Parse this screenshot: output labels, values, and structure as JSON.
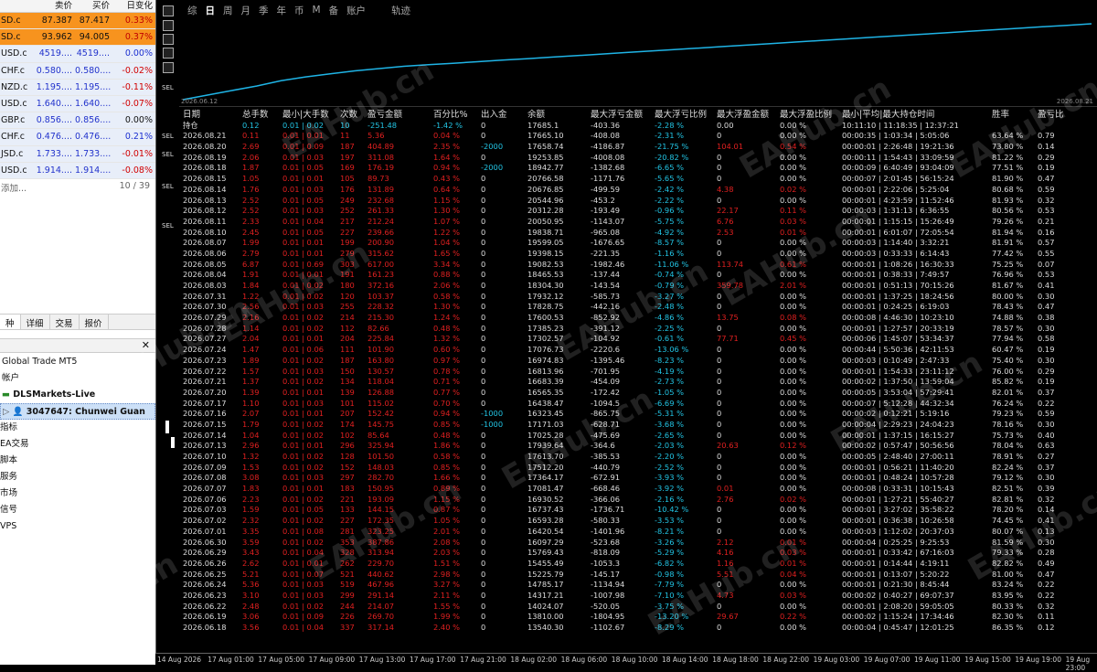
{
  "market_watch": {
    "headers": [
      "",
      "卖价",
      "买价",
      "日变化"
    ],
    "rows": [
      {
        "symbol": "SD.c",
        "bid": "87.387",
        "ask": "87.417",
        "change": "0.33%",
        "highlight": true,
        "dir": "pos"
      },
      {
        "symbol": "SD.c",
        "bid": "93.962",
        "ask": "94.005",
        "change": "0.37%",
        "highlight": true,
        "dir": "pos"
      },
      {
        "symbol": "USD.c",
        "bid": "4519....",
        "ask": "4519....",
        "change": "0.00%",
        "highlight": false,
        "dir": "pos"
      },
      {
        "symbol": "CHF.c",
        "bid": "0.580....",
        "ask": "0.580....",
        "change": "-0.02%",
        "highlight": false,
        "dir": "neg"
      },
      {
        "symbol": "NZD.c",
        "bid": "1.195....",
        "ask": "1.195....",
        "change": "-0.11%",
        "highlight": false,
        "dir": "neg"
      },
      {
        "symbol": "USD.c",
        "bid": "1.640....",
        "ask": "1.640....",
        "change": "-0.07%",
        "highlight": false,
        "dir": "neg"
      },
      {
        "symbol": "GBP.c",
        "bid": "0.856....",
        "ask": "0.856....",
        "change": "0.00%",
        "highlight": false,
        "dir": "none"
      },
      {
        "symbol": "CHF.c",
        "bid": "0.476....",
        "ask": "0.476....",
        "change": "0.21%",
        "highlight": false,
        "dir": "pos"
      },
      {
        "symbol": "JSD.c",
        "bid": "1.733....",
        "ask": "1.733....",
        "change": "-0.01%",
        "highlight": false,
        "dir": "neg"
      },
      {
        "symbol": "USD.c",
        "bid": "1.914....",
        "ask": "1.914....",
        "change": "-0.08%",
        "highlight": false,
        "dir": "neg"
      }
    ],
    "add_label": "添加...",
    "count": "10 / 39"
  },
  "tabs": [
    "种",
    "详细",
    "交易",
    "报价"
  ],
  "navigator": {
    "items": [
      "Global Trade MT5",
      "帐户",
      "DLSMarkets-Live",
      "3047647: Chunwei Guan",
      "指标",
      "EA交易",
      "脚本",
      "服务",
      "市场",
      "信号",
      "VPS"
    ]
  },
  "toolbar": {
    "items": [
      "综",
      "日",
      "周",
      "月",
      "季",
      "年",
      "币",
      "M",
      "备",
      "账户",
      "轨迹"
    ],
    "active_index": 1
  },
  "chart": {
    "date_left": "2026.06.12",
    "date_right": "2026.08.21",
    "series_color": "#1fb4e6",
    "equity": [
      0,
      0.06,
      0.12,
      0.18,
      0.25,
      0.3,
      0.34,
      0.38,
      0.41,
      0.44,
      0.46,
      0.48,
      0.5,
      0.52,
      0.54,
      0.56,
      0.58,
      0.6,
      0.62,
      0.64,
      0.66,
      0.68,
      0.7,
      0.72,
      0.74,
      0.76,
      0.78,
      0.8,
      0.82,
      0.84,
      0.86,
      0.88,
      0.9,
      0.92,
      0.94,
      0.96,
      0.98,
      1.0
    ]
  },
  "grid": {
    "headers": [
      "日期",
      "总手数",
      "最小|大手数",
      "次数",
      "盈亏金额",
      "百分比%",
      "出入金",
      "余额",
      "最大浮亏金额",
      "最大浮亏比例",
      "最大浮盈金额",
      "最大浮盈比例",
      "最小|平均|最大持仓时间",
      "胜率",
      "盈亏比"
    ],
    "rows": [
      [
        "持仓",
        "0.12",
        "0.01 | 0.02",
        "10",
        "-251.48",
        "-1.42 %",
        "0",
        "17685.1",
        "-403.36",
        "-2.28 %",
        "0.00",
        "0.00 %",
        "10:11:10 | 11:18:35 | 12:37:21",
        "",
        ""
      ],
      [
        "2026.08.21",
        "0.11",
        "0.01 | 0.01",
        "11",
        "5.36",
        "0.04 %",
        "0",
        "17665.10",
        "-408.08",
        "-2.31 %",
        "0",
        "0.00 %",
        "00:00:35 | 1:03:34 | 5:05:06",
        "63.64 %",
        "0.79"
      ],
      [
        "2026.08.20",
        "2.69",
        "0.01 | 0.09",
        "187",
        "404.89",
        "2.35 %",
        "-2000",
        "17658.74",
        "-4186.87",
        "-21.75 %",
        "104.01",
        "0.54 %",
        "00:00:01 | 2:26:48 | 19:21:36",
        "73.80 %",
        "0.14"
      ],
      [
        "2026.08.19",
        "2.06",
        "0.01 | 0.03",
        "197",
        "311.08",
        "1.64 %",
        "0",
        "19253.85",
        "-4008.08",
        "-20.82 %",
        "0",
        "0.00 %",
        "00:00:11 | 1:54:43 | 33:09:59",
        "81.22 %",
        "0.29"
      ],
      [
        "2026.08.18",
        "1.87",
        "0.01 | 0.05",
        "169",
        "176.19",
        "0.94 %",
        "-2000",
        "18942.77",
        "-1382.68",
        "-6.65 %",
        "0",
        "0.00 %",
        "00:00:09 | 6:40:49 | 93:04:09",
        "77.51 %",
        "0.19"
      ],
      [
        "2026.08.15",
        "1.05",
        "0.01 | 0.01",
        "105",
        "89.73",
        "0.43 %",
        "0",
        "20766.58",
        "-1171.76",
        "-5.65 %",
        "0",
        "0.00 %",
        "00:00:07 | 2:01:45 | 56:15:24",
        "81.90 %",
        "0.47"
      ],
      [
        "2026.08.14",
        "1.76",
        "0.01 | 0.03",
        "176",
        "131.89",
        "0.64 %",
        "0",
        "20676.85",
        "-499.59",
        "-2.42 %",
        "4.38",
        "0.02 %",
        "00:00:01 | 2:22:06 | 5:25:04",
        "80.68 %",
        "0.59"
      ],
      [
        "2026.08.13",
        "2.52",
        "0.01 | 0.05",
        "249",
        "232.68",
        "1.15 %",
        "0",
        "20544.96",
        "-453.2",
        "-2.22 %",
        "0",
        "0.00 %",
        "00:00:01 | 4:23:59 | 11:52:46",
        "81.93 %",
        "0.32"
      ],
      [
        "2026.08.12",
        "2.52",
        "0.01 | 0.03",
        "252",
        "261.33",
        "1.30 %",
        "0",
        "20312.28",
        "-193.49",
        "-0.96 %",
        "22.17",
        "0.11 %",
        "00:00:03 | 1:31:13 | 6:36:55",
        "80.56 %",
        "0.53"
      ],
      [
        "2026.08.11",
        "2.33",
        "0.01 | 0.04",
        "217",
        "212.24",
        "1.07 %",
        "0",
        "20050.95",
        "-1143.07",
        "-5.75 %",
        "6.76",
        "0.03 %",
        "00:00:01 | 1:15:15 | 15:26:49",
        "79.26 %",
        "0.21"
      ],
      [
        "2026.08.10",
        "2.45",
        "0.01 | 0.05",
        "227",
        "239.66",
        "1.22 %",
        "0",
        "19838.71",
        "-965.08",
        "-4.92 %",
        "2.53",
        "0.01 %",
        "00:00:01 | 6:01:07 | 72:05:54",
        "81.94 %",
        "0.16"
      ],
      [
        "2026.08.07",
        "1.99",
        "0.01 | 0.01",
        "199",
        "200.90",
        "1.04 %",
        "0",
        "19599.05",
        "-1676.65",
        "-8.57 %",
        "0",
        "0.00 %",
        "00:00:03 | 1:14:40 | 3:32:21",
        "81.91 %",
        "0.57"
      ],
      [
        "2026.08.06",
        "2.79",
        "0.01 | 0.01",
        "279",
        "315.62",
        "1.65 %",
        "0",
        "19398.15",
        "-221.35",
        "-1.16 %",
        "0",
        "0.00 %",
        "00:00:03 | 0:33:33 | 6:14:43",
        "77.42 %",
        "0.55"
      ],
      [
        "2026.08.05",
        "6.87",
        "0.01 | 0.69",
        "303",
        "617.00",
        "3.34 %",
        "0",
        "19082.53",
        "-1982.46",
        "-11.06 %",
        "113.74",
        "0.61 %",
        "00:00:01 | 1:08:26 | 16:30:33",
        "75.25 %",
        "0.07"
      ],
      [
        "2026.08.04",
        "1.91",
        "0.01 | 0.01",
        "191",
        "161.23",
        "0.88 %",
        "0",
        "18465.53",
        "-137.44",
        "-0.74 %",
        "0",
        "0.00 %",
        "00:00:01 | 0:38:33 | 7:49:57",
        "76.96 %",
        "0.53"
      ],
      [
        "2026.08.03",
        "1.84",
        "0.01 | 0.02",
        "180",
        "372.16",
        "2.06 %",
        "0",
        "18304.30",
        "-143.54",
        "-0.79 %",
        "359.78",
        "2.01 %",
        "00:00:01 | 0:51:13 | 70:15:26",
        "81.67 %",
        "0.41"
      ],
      [
        "2026.07.31",
        "1.22",
        "0.01 | 0.02",
        "120",
        "103.37",
        "0.58 %",
        "0",
        "17932.12",
        "-585.73",
        "-3.27 %",
        "0",
        "0.00 %",
        "00:00:01 | 1:37:25 | 18:24:56",
        "80.00 %",
        "0.30"
      ],
      [
        "2026.07.30",
        "2.56",
        "0.01 | 0.03",
        "255",
        "228.32",
        "1.30 %",
        "0",
        "17828.75",
        "-442.16",
        "-2.48 %",
        "0",
        "0.00 %",
        "00:00:01 | 0:24:25 | 6:19:03",
        "78.43 %",
        "0.47"
      ],
      [
        "2026.07.29",
        "2.16",
        "0.01 | 0.02",
        "214",
        "215.30",
        "1.24 %",
        "0",
        "17600.53",
        "-852.92",
        "-4.86 %",
        "13.75",
        "0.08 %",
        "00:00:08 | 4:46:30 | 10:23:10",
        "74.88 %",
        "0.38"
      ],
      [
        "2026.07.28",
        "1.14",
        "0.01 | 0.02",
        "112",
        "82.66",
        "0.48 %",
        "0",
        "17385.23",
        "-391.12",
        "-2.25 %",
        "0",
        "0.00 %",
        "00:00:01 | 1:27:57 | 20:33:19",
        "78.57 %",
        "0.30"
      ],
      [
        "2026.07.27",
        "2.04",
        "0.01 | 0.01",
        "204",
        "225.84",
        "1.32 %",
        "0",
        "17302.57",
        "-104.92",
        "-0.61 %",
        "77.71",
        "0.45 %",
        "00:00:06 | 1:45:07 | 53:34:37",
        "77.94 %",
        "0.58"
      ],
      [
        "2026.07.24",
        "1.47",
        "0.01 | 0.06",
        "111",
        "101.90",
        "0.60 %",
        "0",
        "17076.73",
        "-2220.6",
        "-13.06 %",
        "0",
        "0.00 %",
        "00:00:44 | 5:50:36 | 42:11:53",
        "60.47 %",
        "0.19"
      ],
      [
        "2026.07.23",
        "1.89",
        "0.01 | 0.02",
        "187",
        "163.80",
        "0.97 %",
        "0",
        "16974.83",
        "-1395.46",
        "-8.23 %",
        "0",
        "0.00 %",
        "00:00:03 | 0:10:49 | 2:47:33",
        "75.40 %",
        "0.30"
      ],
      [
        "2026.07.22",
        "1.57",
        "0.01 | 0.03",
        "150",
        "130.57",
        "0.78 %",
        "0",
        "16813.96",
        "-701.95",
        "-4.19 %",
        "0",
        "0.00 %",
        "00:00:01 | 1:54:33 | 23:11:12",
        "76.00 %",
        "0.29"
      ],
      [
        "2026.07.21",
        "1.37",
        "0.01 | 0.02",
        "134",
        "118.04",
        "0.71 %",
        "0",
        "16683.39",
        "-454.09",
        "-2.73 %",
        "0",
        "0.00 %",
        "00:00:02 | 1:37:50 | 13:59:04",
        "85.82 %",
        "0.19"
      ],
      [
        "2026.07.20",
        "1.39",
        "0.01 | 0.01",
        "139",
        "126.88",
        "0.77 %",
        "0",
        "16565.35",
        "-172.42",
        "-1.05 %",
        "0",
        "0.00 %",
        "00:00:05 | 3:53:04 | 57:29:41",
        "82.01 %",
        "0.37"
      ],
      [
        "2026.07.17",
        "1.10",
        "0.01 | 0.03",
        "101",
        "115.02",
        "0.70 %",
        "0",
        "16438.47",
        "-1094.5",
        "-6.69 %",
        "0",
        "0.00 %",
        "00:00:07 | 5:12:28 | 44:32:34",
        "76.24 %",
        "0.22"
      ],
      [
        "2026.07.16",
        "2.07",
        "0.01 | 0.01",
        "207",
        "152.42",
        "0.94 %",
        "-1000",
        "16323.45",
        "-865.75",
        "-5.31 %",
        "0",
        "0.00 %",
        "00:00:02 | 0:12:21 | 5:19:16",
        "79.23 %",
        "0.59"
      ],
      [
        "2026.07.15",
        "1.79",
        "0.01 | 0.02",
        "174",
        "145.75",
        "0.85 %",
        "-1000",
        "17171.03",
        "-628.71",
        "-3.68 %",
        "0",
        "0.00 %",
        "00:00:04 | 2:29:23 | 24:04:23",
        "78.16 %",
        "0.30"
      ],
      [
        "2026.07.14",
        "1.04",
        "0.01 | 0.02",
        "102",
        "85.64",
        "0.48 %",
        "0",
        "17025.28",
        "-475.69",
        "-2.65 %",
        "0",
        "0.00 %",
        "00:00:01 | 1:37:15 | 16:15:27",
        "75.73 %",
        "0.40"
      ],
      [
        "2026.07.13",
        "2.96",
        "0.01 | 0.01",
        "296",
        "325.94",
        "1.86 %",
        "0",
        "17939.64",
        "-364.6",
        "-2.03 %",
        "20.63",
        "0.12 %",
        "00:00:02 | 0:57:47 | 50:56:56",
        "78.04 %",
        "0.63"
      ],
      [
        "2026.07.10",
        "1.32",
        "0.01 | 0.02",
        "128",
        "101.50",
        "0.58 %",
        "0",
        "17613.70",
        "-385.53",
        "-2.20 %",
        "0",
        "0.00 %",
        "00:00:05 | 2:48:40 | 27:00:11",
        "78.91 %",
        "0.27"
      ],
      [
        "2026.07.09",
        "1.53",
        "0.01 | 0.02",
        "152",
        "148.03",
        "0.85 %",
        "0",
        "17512.20",
        "-440.79",
        "-2.52 %",
        "0",
        "0.00 %",
        "00:00:01 | 0:56:21 | 11:40:20",
        "82.24 %",
        "0.37"
      ],
      [
        "2026.07.08",
        "3.08",
        "0.01 | 0.03",
        "297",
        "282.70",
        "1.66 %",
        "0",
        "17364.17",
        "-672.91",
        "-3.93 %",
        "0",
        "0.00 %",
        "00:00:01 | 0:48:24 | 10:57:28",
        "79.12 %",
        "0.30"
      ],
      [
        "2026.07.07",
        "1.83",
        "0.01 | 0.01",
        "183",
        "150.95",
        "0.89 %",
        "0",
        "17081.47",
        "-668.46",
        "-3.92 %",
        "0.01",
        "0.00 %",
        "00:00:08 | 0:33:31 | 10:15:43",
        "82.51 %",
        "0.39"
      ],
      [
        "2026.07.06",
        "2.23",
        "0.01 | 0.02",
        "221",
        "193.09",
        "1.15 %",
        "0",
        "16930.52",
        "-366.06",
        "-2.16 %",
        "2.76",
        "0.02 %",
        "00:00:01 | 1:27:21 | 55:40:27",
        "82.81 %",
        "0.32"
      ],
      [
        "2026.07.03",
        "1.59",
        "0.01 | 0.05",
        "133",
        "144.15",
        "0.87 %",
        "0",
        "16737.43",
        "-1736.71",
        "-10.42 %",
        "0",
        "0.00 %",
        "00:00:01 | 3:27:02 | 35:58:22",
        "78.20 %",
        "0.14"
      ],
      [
        "2026.07.02",
        "2.32",
        "0.01 | 0.02",
        "227",
        "172.35",
        "1.05 %",
        "0",
        "16593.28",
        "-580.33",
        "-3.53 %",
        "0",
        "0.00 %",
        "00:00:01 | 0:36:38 | 10:26:58",
        "74.45 %",
        "0.41"
      ],
      [
        "2026.07.01",
        "3.35",
        "0.01 | 0.08",
        "281",
        "323.25",
        "2.01 %",
        "0",
        "16420.54",
        "-1401.96",
        "-8.21 %",
        "0",
        "0.00 %",
        "00:00:03 | 1:12:02 | 20:37:03",
        "80.07 %",
        "0.13"
      ],
      [
        "2026.06.30",
        "3.59",
        "0.01 | 0.02",
        "353",
        "387.86",
        "2.08 %",
        "0",
        "16097.29",
        "-523.68",
        "-3.26 %",
        "2.12",
        "0.01 %",
        "00:00:04 | 0:25:25 | 9:25:53",
        "81.59 %",
        "0.30"
      ],
      [
        "2026.06.29",
        "3.43",
        "0.01 | 0.04",
        "328",
        "313.94",
        "2.03 %",
        "0",
        "15769.43",
        "-818.09",
        "-5.29 %",
        "4.16",
        "0.03 %",
        "00:00:01 | 0:33:42 | 67:16:03",
        "79.33 %",
        "0.28"
      ],
      [
        "2026.06.26",
        "2.62",
        "0.01 | 0.01",
        "262",
        "229.70",
        "1.51 %",
        "0",
        "15455.49",
        "-1053.3",
        "-6.82 %",
        "1.16",
        "0.01 %",
        "00:00:01 | 0:14:44 | 4:19:11",
        "82.82 %",
        "0.49"
      ],
      [
        "2026.06.25",
        "5.21",
        "0.01 | 0.07",
        "521",
        "440.62",
        "2.98 %",
        "0",
        "15225.79",
        "-145.17",
        "-0.98 %",
        "5.51",
        "0.04 %",
        "00:00:01 | 0:13:07 | 5:20:22",
        "81.00 %",
        "0.47"
      ],
      [
        "2026.06.24",
        "5.36",
        "0.01 | 0.03",
        "519",
        "467.96",
        "3.27 %",
        "0",
        "14785.17",
        "-1134.94",
        "-7.79 %",
        "0",
        "0.00 %",
        "00:00:01 | 0:21:30 | 8:45:44",
        "83.24 %",
        "0.22"
      ],
      [
        "2026.06.23",
        "3.10",
        "0.01 | 0.03",
        "299",
        "291.14",
        "2.11 %",
        "0",
        "14317.21",
        "-1007.98",
        "-7.10 %",
        "4.73",
        "0.03 %",
        "00:00:02 | 0:40:27 | 69:07:37",
        "83.95 %",
        "0.22"
      ],
      [
        "2026.06.22",
        "2.48",
        "0.01 | 0.02",
        "244",
        "214.07",
        "1.55 %",
        "0",
        "14024.07",
        "-520.05",
        "-3.75 %",
        "0",
        "0.00 %",
        "00:00:01 | 2:08:20 | 59:05:05",
        "80.33 %",
        "0.32"
      ],
      [
        "2026.06.19",
        "3.06",
        "0.01 | 0.09",
        "226",
        "269.70",
        "1.99 %",
        "0",
        "13810.00",
        "-1804.95",
        "-13.20 %",
        "29.67",
        "0.22 %",
        "00:00:02 | 1:15:24 | 17:34:46",
        "82.30 %",
        "0.11"
      ],
      [
        "2026.06.18",
        "3.56",
        "0.01 | 0.04",
        "337",
        "317.14",
        "2.40 %",
        "0",
        "13540.30",
        "-1102.67",
        "-8.29 %",
        "0",
        "0.00 %",
        "00:00:04 | 0:45:47 | 12:01:25",
        "86.35 %",
        "0.12"
      ]
    ]
  },
  "time_axis": [
    "14 Aug 2026",
    "17 Aug 01:00",
    "17 Aug 05:00",
    "17 Aug 09:00",
    "17 Aug 13:00",
    "17 Aug 17:00",
    "17 Aug 21:00",
    "18 Aug 02:00",
    "18 Aug 06:00",
    "18 Aug 10:00",
    "18 Aug 14:00",
    "18 Aug 18:00",
    "18 Aug 22:00",
    "19 Aug 03:00",
    "19 Aug 07:00",
    "19 Aug 11:00",
    "19 Aug 15:00",
    "19 Aug 19:00",
    "19 Aug 23:00"
  ],
  "watermark": "EAHub.cn",
  "colors": {
    "highlight_row": "#f7931e",
    "loss": "#e02020",
    "cyan": "#22c4e4",
    "equity_line": "#1fb4e6"
  }
}
